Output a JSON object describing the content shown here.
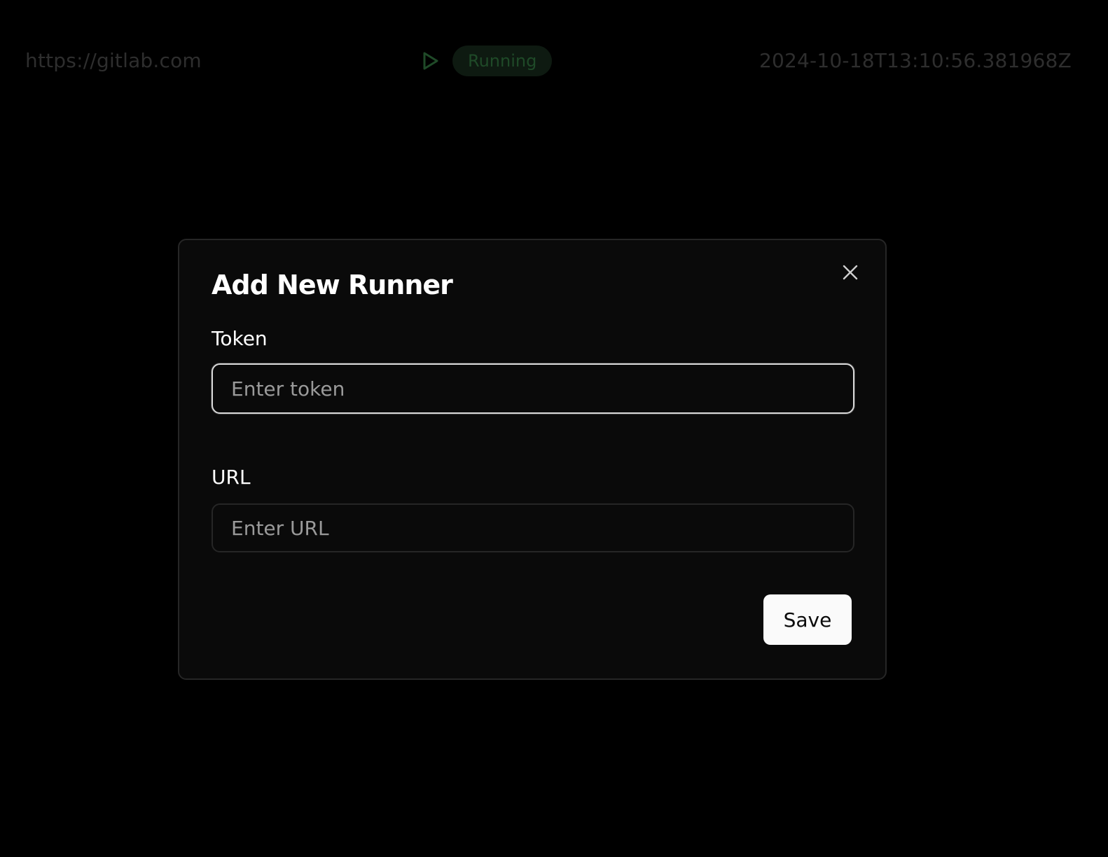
{
  "background": {
    "url_text": "https://gitlab.com",
    "status_icon": "play-icon",
    "status_label": "Running",
    "timestamp": "2024-10-18T13:10:56.381968Z"
  },
  "modal": {
    "title": "Add New Runner",
    "close_icon": "close-icon",
    "token": {
      "label": "Token",
      "placeholder": "Enter token",
      "value": ""
    },
    "url": {
      "label": "URL",
      "placeholder": "Enter URL",
      "value": ""
    },
    "save_label": "Save"
  },
  "colors": {
    "background": "#000000",
    "modal_bg": "#0a0a0a",
    "modal_border": "#262626",
    "status_green": "#1f4a28",
    "button_bg": "#fafafa"
  }
}
